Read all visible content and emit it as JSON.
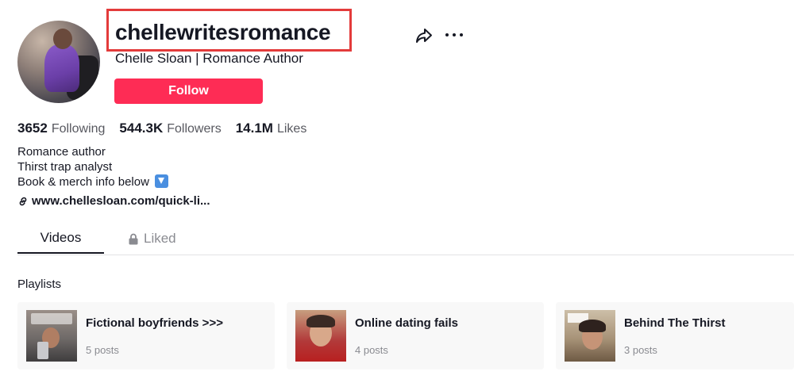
{
  "profile": {
    "username": "chellewritesromance",
    "nickname": "Chelle Sloan | Romance Author",
    "follow_label": "Follow"
  },
  "stats": [
    {
      "value": "3652",
      "label": "Following"
    },
    {
      "value": "544.3K",
      "label": "Followers"
    },
    {
      "value": "14.1M",
      "label": "Likes"
    }
  ],
  "bio": {
    "lines": [
      "Romance author",
      "Thirst trap analyst",
      "Book & merch info below"
    ],
    "link": "www.chellesloan.com/quick-li..."
  },
  "tabs": [
    {
      "label": "Videos",
      "active": true
    },
    {
      "label": "Liked",
      "locked": true
    }
  ],
  "playlists": {
    "title": "Playlists",
    "items": [
      {
        "title": "Fictional boyfriends >>>",
        "posts": "5 posts"
      },
      {
        "title": "Online dating fails",
        "posts": "4 posts"
      },
      {
        "title": "Behind The Thirst",
        "posts": "3 posts"
      }
    ]
  },
  "icons": {
    "share": "share-icon",
    "more": "more-options-icon",
    "link": "link-icon",
    "lock": "lock-icon",
    "down_arrow": "down-arrow-emoji"
  },
  "colors": {
    "follow_button": "#fe2c55",
    "highlight_box": "#e33b3b",
    "text_primary": "#161823",
    "text_secondary": "#8a8b91"
  }
}
